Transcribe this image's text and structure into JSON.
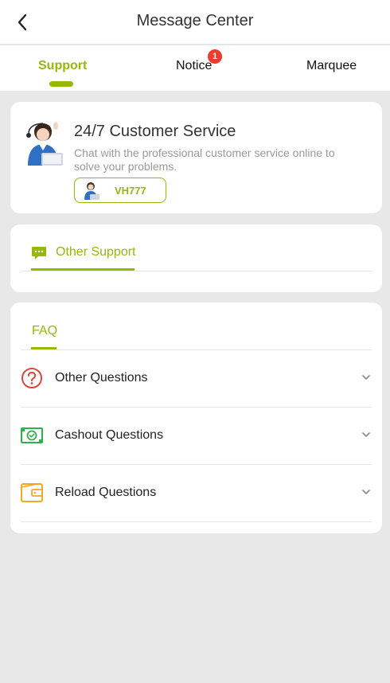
{
  "header": {
    "title": "Message Center"
  },
  "tabs": [
    {
      "label": "Support",
      "active": true
    },
    {
      "label": "Notice",
      "badge": "1"
    },
    {
      "label": "Marquee"
    }
  ],
  "customer_service": {
    "title": "24/7 Customer Service",
    "description": "Chat with the professional customer service online to solve your problems.",
    "agent_name": "VH777"
  },
  "other_support": {
    "label": "Other Support"
  },
  "faq": {
    "label": "FAQ",
    "items": [
      {
        "label": "Other Questions",
        "icon": "question-icon"
      },
      {
        "label": "Cashout Questions",
        "icon": "cash-icon"
      },
      {
        "label": "Reload Questions",
        "icon": "wallet-icon"
      }
    ]
  },
  "colors": {
    "accent": "#94b80b",
    "badge": "#ef3a2e",
    "question_icon": "#e0473c",
    "cash_icon": "#2bb24c",
    "wallet_icon": "#f5a623"
  }
}
